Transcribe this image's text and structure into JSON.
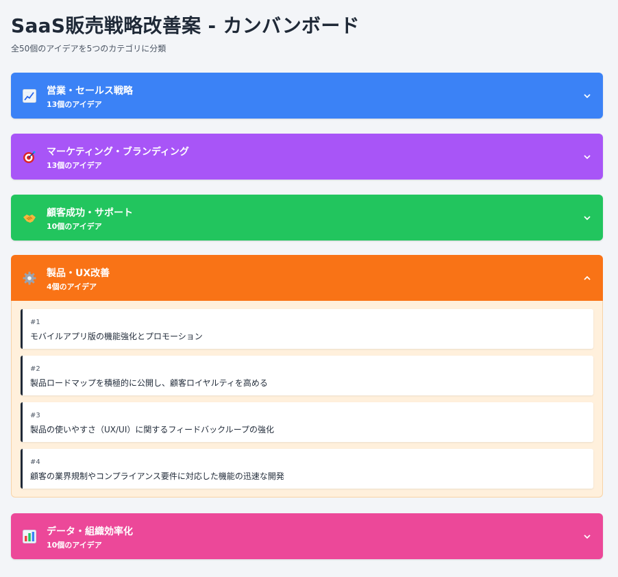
{
  "page": {
    "title": "SaaS販売戦略改善案 - カンバンボード",
    "subtitle": "全50個のアイデアを5つのカテゴリに分類"
  },
  "categories": [
    {
      "icon": "chart-increasing-icon",
      "name": "営業・セールス戦略",
      "count": "13個のアイデア",
      "color": "#3b82f6",
      "expanded": false
    },
    {
      "icon": "target-icon",
      "name": "マーケティング・ブランディング",
      "count": "13個のアイデア",
      "color": "#a855f7",
      "expanded": false
    },
    {
      "icon": "handshake-icon",
      "name": "顧客成功・サポート",
      "count": "10個のアイデア",
      "color": "#22c55e",
      "expanded": false
    },
    {
      "icon": "gear-icon",
      "name": "製品・UX改善",
      "count": "4個のアイデア",
      "color": "#f97316",
      "expanded": true,
      "ideas": [
        {
          "num": "#1",
          "text": "モバイルアプリ版の機能強化とプロモーション"
        },
        {
          "num": "#2",
          "text": "製品ロードマップを積極的に公開し、顧客ロイヤルティを高める"
        },
        {
          "num": "#3",
          "text": "製品の使いやすさ（UX/UI）に関するフィードバックループの強化"
        },
        {
          "num": "#4",
          "text": "顧客の業界規制やコンプライアンス要件に対応した機能の迅速な開発"
        }
      ]
    },
    {
      "icon": "bar-chart-icon",
      "name": "データ・組織効率化",
      "count": "10個のアイデア",
      "color": "#ec4899",
      "expanded": false
    }
  ]
}
